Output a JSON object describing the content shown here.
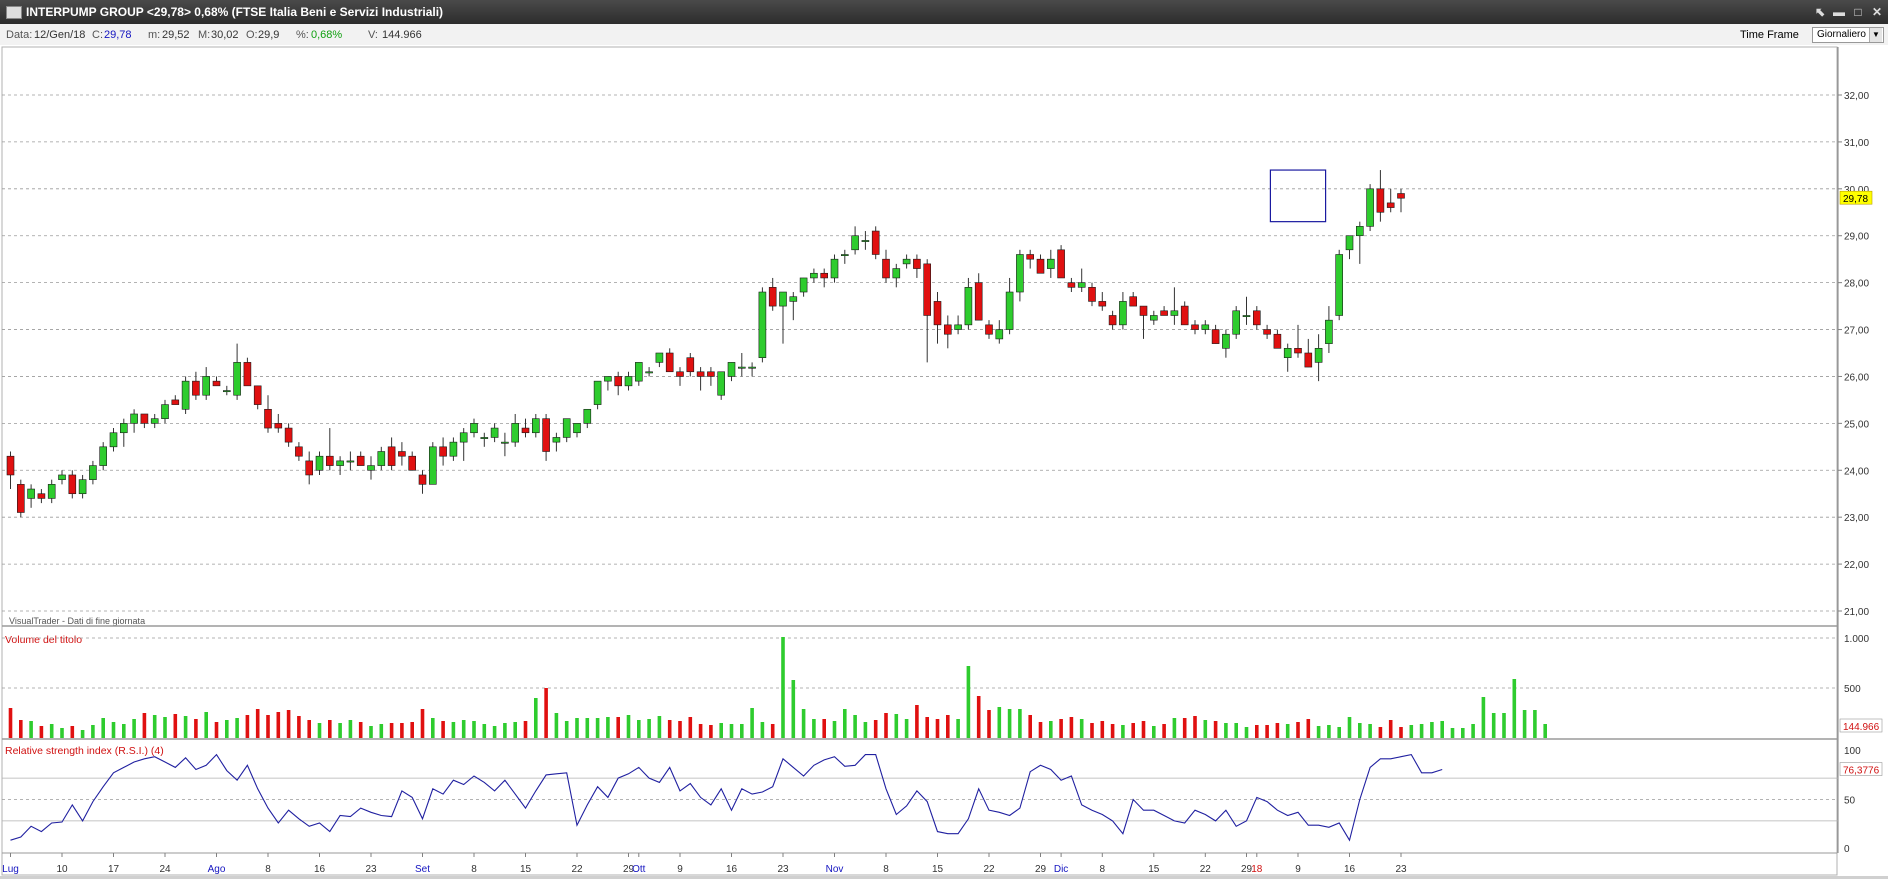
{
  "window": {
    "title": "INTERPUMP GROUP <29,78> 0,68%  (FTSE Italia Beni e Servizi Industriali)",
    "buttons": [
      "⬉",
      "▬",
      "□",
      "✕"
    ]
  },
  "infobar": {
    "date_label": "Data:",
    "date": "12/Gen/18",
    "close_label": "C:",
    "close": "29,78",
    "min_label": "m:",
    "min": "29,52",
    "max_label": "M:",
    "max": "30,02",
    "open_label": "O:",
    "open": "29,9",
    "pct_label": "%:",
    "pct": "0,68%",
    "vol_label": "V:",
    "vol": "144.966",
    "timeframe_label": "Time Frame",
    "timeframe_value": "Giornaliero"
  },
  "colors": {
    "up": "#2ecc2e",
    "down": "#e01010",
    "rsi_line": "#2020a0",
    "highlight_box": "#1a1aa0",
    "panel_label": "#d01010",
    "price_tag_bg": "#ffff00"
  },
  "chart_data": [
    {
      "type": "candlestick",
      "title": "",
      "ylim": [
        21,
        32.5
      ],
      "y_ticks": [
        "21,00",
        "22,00",
        "23,00",
        "24,00",
        "25,00",
        "26,00",
        "27,00",
        "28,00",
        "29,00",
        "30,00",
        "31,00",
        "32,00"
      ],
      "current_price_label": "29,78",
      "watermark": "VisualTrader - Dati di fine giornata",
      "x_tick_labels": [
        {
          "label": "Lug",
          "index": 0
        },
        {
          "label": "10",
          "index": 5
        },
        {
          "label": "17",
          "index": 10
        },
        {
          "label": "24",
          "index": 15
        },
        {
          "label": "Ago",
          "index": 20
        },
        {
          "label": "8",
          "index": 25
        },
        {
          "label": "16",
          "index": 30
        },
        {
          "label": "23",
          "index": 35
        },
        {
          "label": "Set",
          "index": 40
        },
        {
          "label": "8",
          "index": 45
        },
        {
          "label": "15",
          "index": 50
        },
        {
          "label": "22",
          "index": 55
        },
        {
          "label": "29",
          "index": 60
        },
        {
          "label": "Ott",
          "index": 61
        },
        {
          "label": "9",
          "index": 65
        },
        {
          "label": "16",
          "index": 70
        },
        {
          "label": "23",
          "index": 75
        },
        {
          "label": "Nov",
          "index": 80
        },
        {
          "label": "8",
          "index": 85
        },
        {
          "label": "15",
          "index": 90
        },
        {
          "label": "22",
          "index": 95
        },
        {
          "label": "29",
          "index": 100
        },
        {
          "label": "Dic",
          "index": 102
        },
        {
          "label": "8",
          "index": 106
        },
        {
          "label": "15",
          "index": 111
        },
        {
          "label": "22",
          "index": 116
        },
        {
          "label": "29",
          "index": 120
        },
        {
          "label": "18",
          "index": 121
        },
        {
          "label": "9",
          "index": 125
        },
        {
          "label": "16",
          "index": 130
        },
        {
          "label": "23",
          "index": 135
        }
      ],
      "highlight": {
        "from_index": 123,
        "to_index": 127,
        "y_low": 29.3,
        "y_high": 30.4
      },
      "ohlc": [
        [
          24.3,
          24.4,
          23.6,
          23.9
        ],
        [
          23.7,
          23.8,
          23.0,
          23.1
        ],
        [
          23.4,
          23.7,
          23.2,
          23.6
        ],
        [
          23.5,
          23.6,
          23.3,
          23.4
        ],
        [
          23.4,
          23.8,
          23.3,
          23.7
        ],
        [
          23.8,
          24.0,
          23.7,
          23.9
        ],
        [
          23.9,
          24.0,
          23.4,
          23.5
        ],
        [
          23.5,
          23.9,
          23.4,
          23.8
        ],
        [
          23.8,
          24.2,
          23.7,
          24.1
        ],
        [
          24.1,
          24.6,
          24.0,
          24.5
        ],
        [
          24.5,
          24.9,
          24.4,
          24.8
        ],
        [
          24.8,
          25.1,
          24.5,
          25.0
        ],
        [
          25.0,
          25.3,
          24.8,
          25.2
        ],
        [
          25.2,
          25.2,
          24.9,
          25.0
        ],
        [
          25.0,
          25.2,
          24.9,
          25.1
        ],
        [
          25.1,
          25.5,
          25.0,
          25.4
        ],
        [
          25.5,
          25.6,
          25.4,
          25.4
        ],
        [
          25.3,
          26.0,
          25.2,
          25.9
        ],
        [
          25.9,
          26.1,
          25.5,
          25.6
        ],
        [
          25.6,
          26.2,
          25.5,
          26.0
        ],
        [
          25.9,
          26.0,
          25.8,
          25.8
        ],
        [
          25.7,
          25.8,
          25.6,
          25.7
        ],
        [
          25.6,
          26.7,
          25.5,
          26.3
        ],
        [
          26.3,
          26.4,
          25.8,
          25.8
        ],
        [
          25.8,
          25.8,
          25.3,
          25.4
        ],
        [
          25.3,
          25.6,
          24.8,
          24.9
        ],
        [
          25.0,
          25.2,
          24.8,
          24.9
        ],
        [
          24.9,
          25.0,
          24.5,
          24.6
        ],
        [
          24.5,
          24.6,
          24.2,
          24.3
        ],
        [
          24.2,
          24.4,
          23.7,
          23.9
        ],
        [
          24.0,
          24.4,
          23.9,
          24.3
        ],
        [
          24.3,
          24.9,
          24.0,
          24.1
        ],
        [
          24.1,
          24.3,
          23.9,
          24.2
        ],
        [
          24.2,
          24.4,
          24.0,
          24.2
        ],
        [
          24.3,
          24.4,
          24.1,
          24.1
        ],
        [
          24.0,
          24.3,
          23.8,
          24.1
        ],
        [
          24.1,
          24.5,
          24.0,
          24.4
        ],
        [
          24.5,
          24.7,
          24.0,
          24.1
        ],
        [
          24.4,
          24.6,
          24.1,
          24.3
        ],
        [
          24.3,
          24.4,
          24.0,
          24.0
        ],
        [
          23.9,
          24.0,
          23.5,
          23.7
        ],
        [
          23.7,
          24.6,
          23.7,
          24.5
        ],
        [
          24.5,
          24.7,
          24.1,
          24.3
        ],
        [
          24.3,
          24.7,
          24.2,
          24.6
        ],
        [
          24.6,
          24.9,
          24.2,
          24.8
        ],
        [
          24.8,
          25.1,
          24.7,
          25.0
        ],
        [
          24.7,
          24.8,
          24.5,
          24.7
        ],
        [
          24.7,
          25.0,
          24.6,
          24.9
        ],
        [
          24.6,
          24.8,
          24.3,
          24.6
        ],
        [
          24.6,
          25.2,
          24.5,
          25.0
        ],
        [
          24.9,
          25.1,
          24.7,
          24.8
        ],
        [
          24.8,
          25.2,
          24.7,
          25.1
        ],
        [
          25.1,
          25.2,
          24.2,
          24.4
        ],
        [
          24.6,
          24.8,
          24.4,
          24.7
        ],
        [
          24.7,
          25.1,
          24.6,
          25.1
        ],
        [
          24.8,
          25.0,
          24.7,
          25.0
        ],
        [
          25.0,
          25.3,
          24.9,
          25.3
        ],
        [
          25.4,
          25.9,
          25.3,
          25.9
        ],
        [
          25.9,
          26.0,
          25.7,
          26.0
        ],
        [
          26.0,
          26.1,
          25.6,
          25.8
        ],
        [
          25.8,
          26.1,
          25.7,
          26.0
        ],
        [
          25.9,
          26.3,
          25.8,
          26.3
        ],
        [
          26.1,
          26.2,
          26.0,
          26.1
        ],
        [
          26.3,
          26.5,
          26.2,
          26.5
        ],
        [
          26.5,
          26.6,
          26.1,
          26.1
        ],
        [
          26.1,
          26.2,
          25.8,
          26.0
        ],
        [
          26.4,
          26.5,
          26.0,
          26.1
        ],
        [
          26.1,
          26.2,
          25.7,
          26.0
        ],
        [
          26.1,
          26.2,
          25.8,
          26.0
        ],
        [
          25.6,
          26.1,
          25.5,
          26.1
        ],
        [
          26.0,
          26.3,
          25.9,
          26.3
        ],
        [
          26.2,
          26.5,
          26.0,
          26.2
        ],
        [
          26.2,
          26.3,
          26.0,
          26.2
        ],
        [
          26.4,
          27.9,
          26.3,
          27.8
        ],
        [
          27.9,
          28.1,
          27.4,
          27.5
        ],
        [
          27.5,
          27.8,
          26.7,
          27.8
        ],
        [
          27.6,
          27.8,
          27.2,
          27.7
        ],
        [
          27.8,
          28.1,
          27.7,
          28.1
        ],
        [
          28.1,
          28.3,
          28.0,
          28.2
        ],
        [
          28.2,
          28.3,
          27.9,
          28.1
        ],
        [
          28.1,
          28.6,
          28.0,
          28.5
        ],
        [
          28.6,
          28.7,
          28.4,
          28.6
        ],
        [
          28.7,
          29.2,
          28.6,
          29.0
        ],
        [
          28.9,
          29.1,
          28.7,
          28.9
        ],
        [
          29.1,
          29.2,
          28.5,
          28.6
        ],
        [
          28.5,
          28.7,
          28.0,
          28.1
        ],
        [
          28.1,
          28.4,
          27.9,
          28.3
        ],
        [
          28.4,
          28.6,
          28.3,
          28.5
        ],
        [
          28.5,
          28.6,
          28.1,
          28.3
        ],
        [
          28.4,
          28.5,
          26.3,
          27.3
        ],
        [
          27.6,
          27.8,
          26.7,
          27.1
        ],
        [
          27.1,
          27.3,
          26.6,
          26.9
        ],
        [
          27.0,
          27.3,
          26.9,
          27.1
        ],
        [
          27.1,
          28.1,
          27.0,
          27.9
        ],
        [
          28.0,
          28.2,
          27.2,
          27.2
        ],
        [
          27.1,
          27.2,
          26.8,
          26.9
        ],
        [
          26.8,
          27.2,
          26.7,
          27.0
        ],
        [
          27.0,
          28.1,
          26.9,
          27.8
        ],
        [
          27.8,
          28.7,
          27.6,
          28.6
        ],
        [
          28.6,
          28.7,
          28.3,
          28.5
        ],
        [
          28.5,
          28.6,
          28.2,
          28.2
        ],
        [
          28.3,
          28.7,
          28.1,
          28.5
        ],
        [
          28.7,
          28.8,
          28.1,
          28.1
        ],
        [
          28.0,
          28.1,
          27.8,
          27.9
        ],
        [
          27.9,
          28.3,
          27.8,
          28.0
        ],
        [
          27.9,
          28.0,
          27.5,
          27.6
        ],
        [
          27.6,
          27.8,
          27.4,
          27.5
        ],
        [
          27.3,
          27.4,
          27.0,
          27.1
        ],
        [
          27.1,
          27.8,
          27.0,
          27.6
        ],
        [
          27.7,
          27.8,
          27.5,
          27.5
        ],
        [
          27.5,
          27.5,
          26.8,
          27.3
        ],
        [
          27.2,
          27.4,
          27.1,
          27.3
        ],
        [
          27.4,
          27.5,
          27.3,
          27.3
        ],
        [
          27.3,
          27.9,
          27.1,
          27.4
        ],
        [
          27.5,
          27.6,
          27.1,
          27.1
        ],
        [
          27.1,
          27.2,
          26.9,
          27.0
        ],
        [
          27.0,
          27.2,
          26.9,
          27.1
        ],
        [
          27.0,
          27.1,
          26.7,
          26.7
        ],
        [
          26.6,
          27.0,
          26.4,
          26.9
        ],
        [
          26.9,
          27.5,
          26.8,
          27.4
        ],
        [
          27.3,
          27.7,
          27.1,
          27.3
        ],
        [
          27.4,
          27.5,
          27.0,
          27.1
        ],
        [
          27.0,
          27.1,
          26.8,
          26.9
        ],
        [
          26.9,
          27.0,
          26.6,
          26.6
        ],
        [
          26.4,
          26.7,
          26.1,
          26.6
        ],
        [
          26.6,
          27.1,
          26.4,
          26.5
        ],
        [
          26.5,
          26.8,
          26.2,
          26.2
        ],
        [
          26.3,
          26.9,
          25.9,
          26.6
        ],
        [
          26.7,
          27.5,
          26.5,
          27.2
        ],
        [
          27.3,
          28.7,
          27.2,
          28.6
        ],
        [
          28.7,
          29.0,
          28.5,
          29.0
        ],
        [
          29.0,
          29.3,
          28.4,
          29.2
        ],
        [
          29.2,
          30.1,
          29.1,
          30.0
        ],
        [
          30.0,
          30.4,
          29.3,
          29.5
        ],
        [
          29.7,
          30.0,
          29.5,
          29.6
        ],
        [
          29.9,
          30.0,
          29.5,
          29.8
        ]
      ]
    },
    {
      "type": "bar",
      "title": "Volume del titolo",
      "ylim": [
        0,
        1030
      ],
      "y_ticks": [
        "500",
        "1.000"
      ],
      "current_value_label": "144.966",
      "values": [
        300,
        180,
        170,
        120,
        140,
        100,
        120,
        80,
        130,
        200,
        160,
        140,
        190,
        250,
        230,
        210,
        240,
        220,
        190,
        260,
        160,
        180,
        200,
        230,
        290,
        230,
        260,
        280,
        220,
        180,
        150,
        180,
        150,
        180,
        160,
        120,
        140,
        150,
        150,
        160,
        290,
        200,
        170,
        160,
        180,
        170,
        140,
        120,
        150,
        160,
        170,
        400,
        500,
        250,
        170,
        200,
        200,
        200,
        210,
        210,
        230,
        180,
        190,
        220,
        180,
        170,
        210,
        140,
        130,
        150,
        140,
        140,
        300,
        160,
        140,
        1010,
        580,
        290,
        190,
        190,
        170,
        290,
        230,
        160,
        180,
        250,
        240,
        190,
        330,
        210,
        190,
        230,
        190,
        720,
        420,
        280,
        310,
        290,
        290,
        230,
        160,
        170,
        190,
        210,
        190,
        150,
        170,
        140,
        130,
        150,
        170,
        120,
        140,
        200,
        200,
        220,
        180,
        170,
        150,
        150,
        110,
        130,
        130,
        150,
        140,
        160,
        190,
        120,
        130,
        110,
        210,
        150,
        140,
        110,
        180,
        110,
        130,
        140,
        160,
        170,
        100,
        100,
        140,
        410,
        250,
        250,
        590,
        280,
        280,
        140
      ]
    },
    {
      "type": "line",
      "title": "Relative strength index (R.S.I.) (4)",
      "ylim": [
        0,
        100
      ],
      "y_ticks": [
        "0",
        "50",
        "100"
      ],
      "reference_lines": [
        30,
        70
      ],
      "current_value_label": "76,3776",
      "values": [
        12,
        15,
        25,
        20,
        28,
        29,
        45,
        30,
        48,
        62,
        75,
        80,
        85,
        88,
        90,
        85,
        80,
        89,
        78,
        82,
        92,
        77,
        68,
        82,
        60,
        42,
        28,
        40,
        32,
        25,
        28,
        20,
        35,
        34,
        42,
        38,
        35,
        34,
        58,
        52,
        32,
        60,
        55,
        68,
        64,
        72,
        66,
        58,
        68,
        55,
        42,
        58,
        73,
        74,
        75,
        26,
        45,
        62,
        52,
        70,
        74,
        80,
        70,
        66,
        80,
        58,
        65,
        52,
        45,
        60,
        40,
        60,
        55,
        57,
        62,
        88,
        80,
        72,
        82,
        87,
        90,
        81,
        82,
        92,
        92,
        60,
        36,
        44,
        58,
        48,
        20,
        18,
        18,
        32,
        60,
        40,
        38,
        35,
        42,
        76,
        82,
        78,
        68,
        72,
        45,
        40,
        36,
        30,
        18,
        50,
        40,
        40,
        35,
        30,
        28,
        40,
        36,
        30,
        40,
        25,
        30,
        52,
        48,
        40,
        35,
        38,
        26,
        26,
        24,
        28,
        12,
        50,
        80,
        88,
        88,
        90,
        92,
        75,
        75,
        78
      ]
    }
  ]
}
